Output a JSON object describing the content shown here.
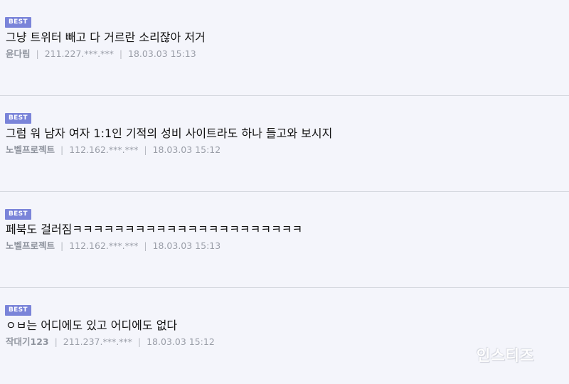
{
  "comments": [
    {
      "badge": "BEST",
      "text": "그냥 트위터 빼고 다 거르란 소리잖아 저거",
      "author": "윤다림",
      "ip": "211.227.***.***",
      "date": "18.03.03 15:13"
    },
    {
      "badge": "BEST",
      "text": "그럼 워 남자 여자 1:1인 기적의 성비 사이트라도 하나 들고와 보시지",
      "author": "노벨프로젝트",
      "ip": "112.162.***.***",
      "date": "18.03.03 15:12"
    },
    {
      "badge": "BEST",
      "text": "페북도 걸러짐ㅋㅋㅋㅋㅋㅋㅋㅋㅋㅋㅋㅋㅋㅋㅋㅋㅋㅋㅋㅋㅋㅋ",
      "author": "노벨프로젝트",
      "ip": "112.162.***.***",
      "date": "18.03.03 15:13"
    },
    {
      "badge": "BEST",
      "text": "ㅇㅂ는 어디에도 있고 어디에도 없다",
      "author": "작대기123",
      "ip": "211.237.***.***",
      "date": "18.03.03 15:12"
    }
  ],
  "meta_separator": "|",
  "watermark": "인스티즈",
  "colors": {
    "background": "#f4f5fb",
    "badge": "#7a84d9",
    "divider": "#d3d6dd",
    "meta_text": "#9a9ea8"
  }
}
